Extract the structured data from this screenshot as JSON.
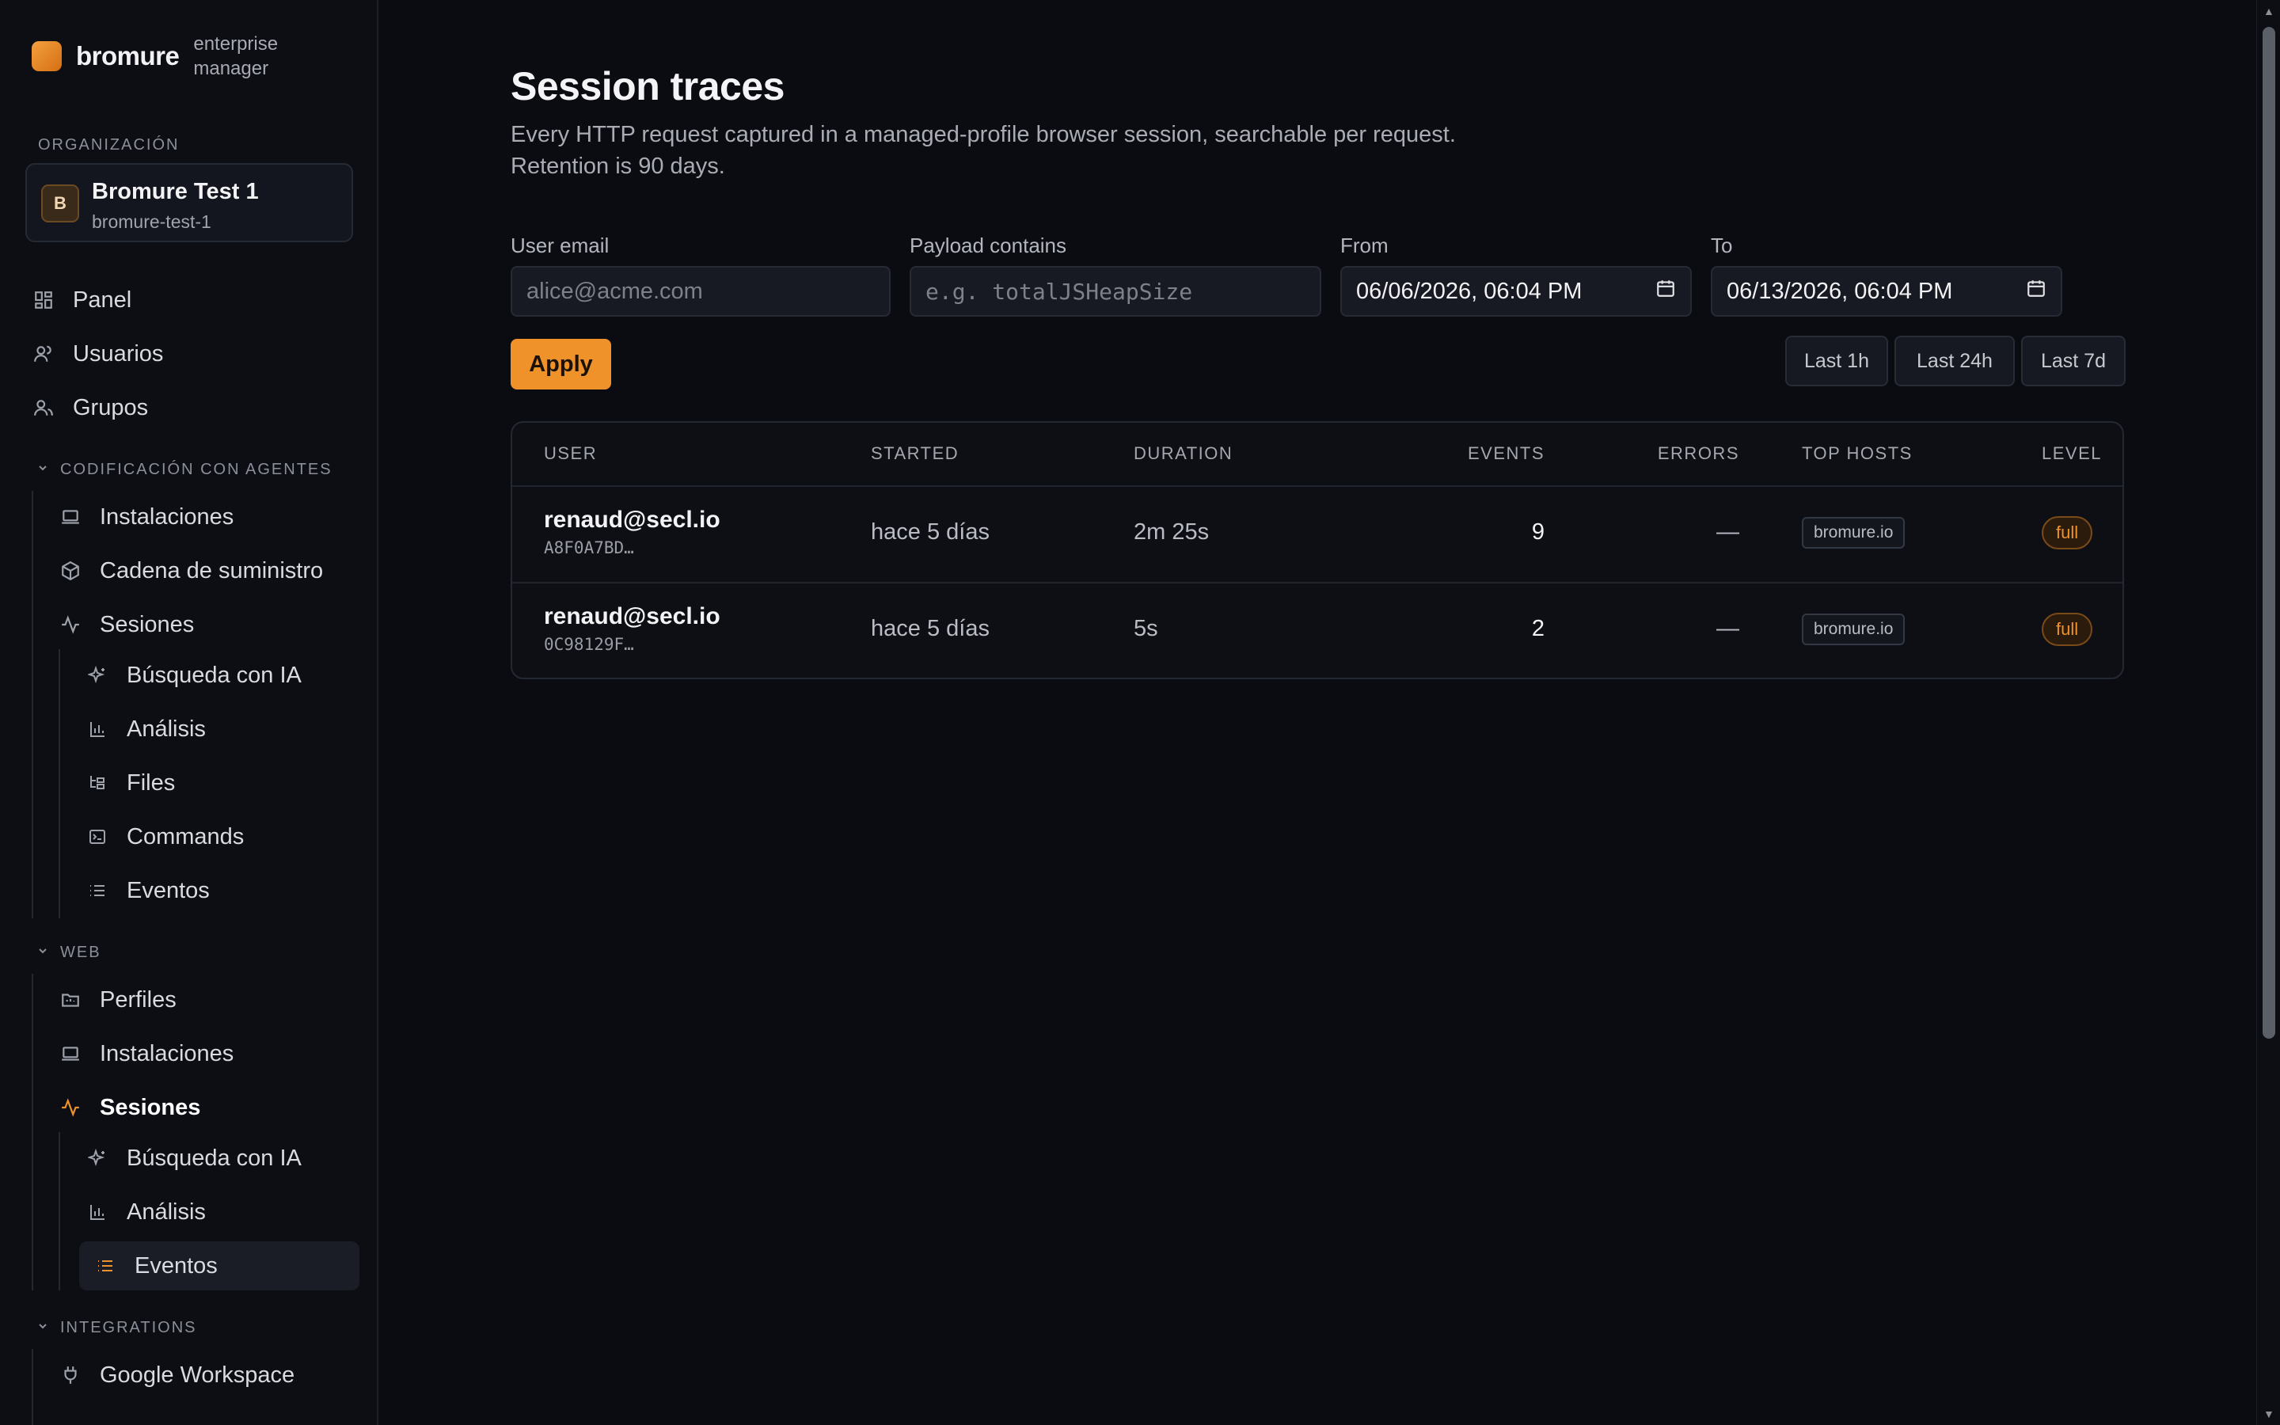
{
  "brand": {
    "name": "bromure",
    "subtitle": "enterprise manager"
  },
  "sidebar": {
    "org_section_label": "ORGANIZACIÓN",
    "org": {
      "initial": "B",
      "name": "Bromure Test 1",
      "slug": "bromure-test-1"
    },
    "top_items": [
      {
        "label": "Panel",
        "icon": "dashboard-icon"
      },
      {
        "label": "Usuarios",
        "icon": "user-icon"
      },
      {
        "label": "Grupos",
        "icon": "users-group-icon"
      }
    ],
    "agent_group": {
      "label": "CODIFICACIÓN CON AGENTES",
      "items": [
        {
          "label": "Instalaciones",
          "icon": "laptop-icon"
        },
        {
          "label": "Cadena de suministro",
          "icon": "package-icon"
        },
        {
          "label": "Sesiones",
          "icon": "activity-icon"
        }
      ],
      "sub_items": [
        {
          "label": "Búsqueda con IA",
          "icon": "sparkles-icon"
        },
        {
          "label": "Análisis",
          "icon": "bar-chart-icon"
        },
        {
          "label": "Files",
          "icon": "folder-tree-icon"
        },
        {
          "label": "Commands",
          "icon": "terminal-icon"
        },
        {
          "label": "Eventos",
          "icon": "list-icon"
        }
      ]
    },
    "web_group": {
      "label": "WEB",
      "items": [
        {
          "label": "Perfiles",
          "icon": "folder-icon"
        },
        {
          "label": "Instalaciones",
          "icon": "laptop-icon"
        },
        {
          "label": "Sesiones",
          "icon": "activity-icon"
        }
      ],
      "sub_items": [
        {
          "label": "Búsqueda con IA",
          "icon": "sparkles-icon"
        },
        {
          "label": "Análisis",
          "icon": "bar-chart-icon"
        },
        {
          "label": "Eventos",
          "icon": "list-icon"
        }
      ]
    },
    "integrations_group": {
      "label": "INTEGRATIONS",
      "items": [
        {
          "label": "Google Workspace",
          "icon": "plug-icon"
        }
      ]
    }
  },
  "page": {
    "title": "Session traces",
    "subtitle": "Every HTTP request captured in a managed-profile browser session, searchable per request. Retention is 90 days."
  },
  "filters": {
    "email_label": "User email",
    "email_placeholder": "alice@acme.com",
    "payload_label": "Payload contains",
    "payload_placeholder": "e.g. totalJSHeapSize",
    "from_label": "From",
    "from_value": "06/06/2026, 06:04 PM",
    "to_label": "To",
    "to_value": "06/13/2026, 06:04 PM",
    "apply_label": "Apply",
    "ranges": [
      "Last 1h",
      "Last 24h",
      "Last 7d"
    ]
  },
  "table": {
    "columns": [
      "USER",
      "STARTED",
      "DURATION",
      "EVENTS",
      "ERRORS",
      "TOP HOSTS",
      "LEVEL"
    ],
    "rows": [
      {
        "user": "renaud@secl.io",
        "id": "A8F0A7BD…",
        "started": "hace 5 días",
        "duration": "2m 25s",
        "events": "9",
        "errors": "—",
        "host": "bromure.io",
        "level": "full"
      },
      {
        "user": "renaud@secl.io",
        "id": "0C98129F…",
        "started": "hace 5 días",
        "duration": "5s",
        "events": "2",
        "errors": "—",
        "host": "bromure.io",
        "level": "full"
      }
    ]
  },
  "colors": {
    "accent": "#f0922a",
    "background": "#0a0c12",
    "sidebar": "#0c0e14"
  }
}
